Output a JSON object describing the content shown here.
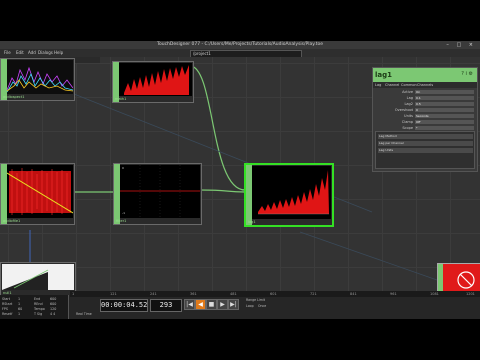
{
  "window": {
    "title": "TouchDesigner 077 - C:/Users/Me/Projects/Tutorials/AudioAnalysis/Play.toe",
    "controls": [
      "–",
      "□",
      "×"
    ]
  },
  "menu": {
    "items": [
      "File",
      "Edit",
      "Add",
      "Dialogs",
      "Help"
    ],
    "path": "/project1"
  },
  "subbar": {
    "items": [
      "Note",
      "Layout"
    ]
  },
  "nodes": {
    "n_topleft_label": "audiospect1",
    "n_top_label": "math1",
    "n_left_label": "audiofile1",
    "n_mid_label": "filter1",
    "n_sel_label": "lag1",
    "n_bottomleft_label": "null1",
    "mid_ruler_top": "0",
    "mid_ruler_bot": "-1"
  },
  "panel": {
    "name": "lag1",
    "icons": "? i ⚙",
    "tabs": [
      "Lag",
      "Channel",
      "Common",
      "Channels"
    ],
    "params": [
      {
        "k": "Active",
        "v": "On"
      },
      {
        "k": "Lag",
        "v": "0.1"
      },
      {
        "k": "Lag2",
        "v": "0.5"
      },
      {
        "k": "Overshoot",
        "v": "0"
      },
      {
        "k": "Units",
        "v": "Seconds"
      },
      {
        "k": "Clamp",
        "v": "Off"
      },
      {
        "k": "Scope",
        "v": "*"
      }
    ],
    "sub": [
      {
        "t": "Lag Method"
      },
      {
        "t": "Lag per Channel"
      },
      {
        "t": "Lag Units"
      }
    ]
  },
  "ruler": {
    "ticks": [
      "1",
      "121",
      "241",
      "361",
      "481",
      "601",
      "721",
      "841",
      "961",
      "1081",
      "1201"
    ]
  },
  "timeline": {
    "timecode": "00:00:04.52",
    "frame": "293",
    "buttons": [
      "|◀",
      "◀",
      "■",
      "▶",
      "▶|"
    ],
    "info": [
      [
        "Start",
        "1",
        "End",
        "600"
      ],
      [
        "RStart",
        "1",
        "REnd",
        "600"
      ],
      [
        "FPS",
        "60",
        "Tempo",
        "120"
      ],
      [
        "Resetf",
        "1",
        "T Sig",
        "4 4"
      ]
    ],
    "range_label": "Range Limit",
    "range_opts": [
      "Loop",
      "Once"
    ],
    "bottom_note": "Real Time"
  }
}
